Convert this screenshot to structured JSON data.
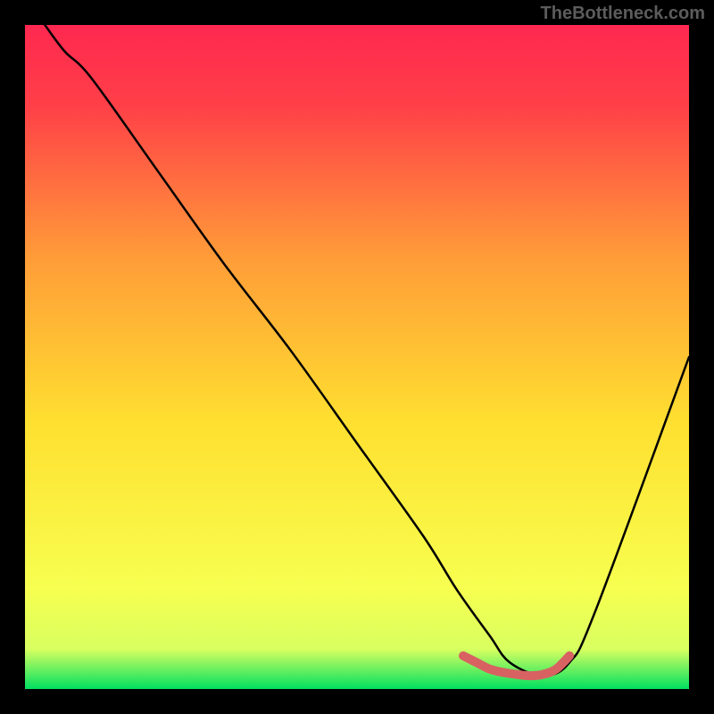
{
  "watermark": "TheBottleneck.com",
  "chart_data": {
    "type": "line",
    "title": "",
    "xlabel": "",
    "ylabel": "",
    "xlim": [
      0,
      100
    ],
    "ylim": [
      0,
      100
    ],
    "background_gradient": {
      "top": "#ff2850",
      "mid": "#ffe030",
      "bottom": "#00e060"
    },
    "series": [
      {
        "name": "bottleneck-curve",
        "color": "#000000",
        "x": [
          3,
          6,
          10,
          20,
          30,
          40,
          50,
          60,
          65,
          70,
          73,
          78,
          82,
          86,
          100
        ],
        "y": [
          100,
          96,
          92,
          78,
          64,
          51,
          37,
          23,
          15,
          8,
          4,
          2,
          4,
          12,
          50
        ]
      },
      {
        "name": "highlight-segment",
        "color": "#d86262",
        "x": [
          66,
          68,
          70,
          72,
          74,
          76,
          78,
          80,
          82
        ],
        "y": [
          5,
          4,
          3,
          2.5,
          2.2,
          2,
          2.2,
          3,
          5
        ]
      }
    ]
  }
}
